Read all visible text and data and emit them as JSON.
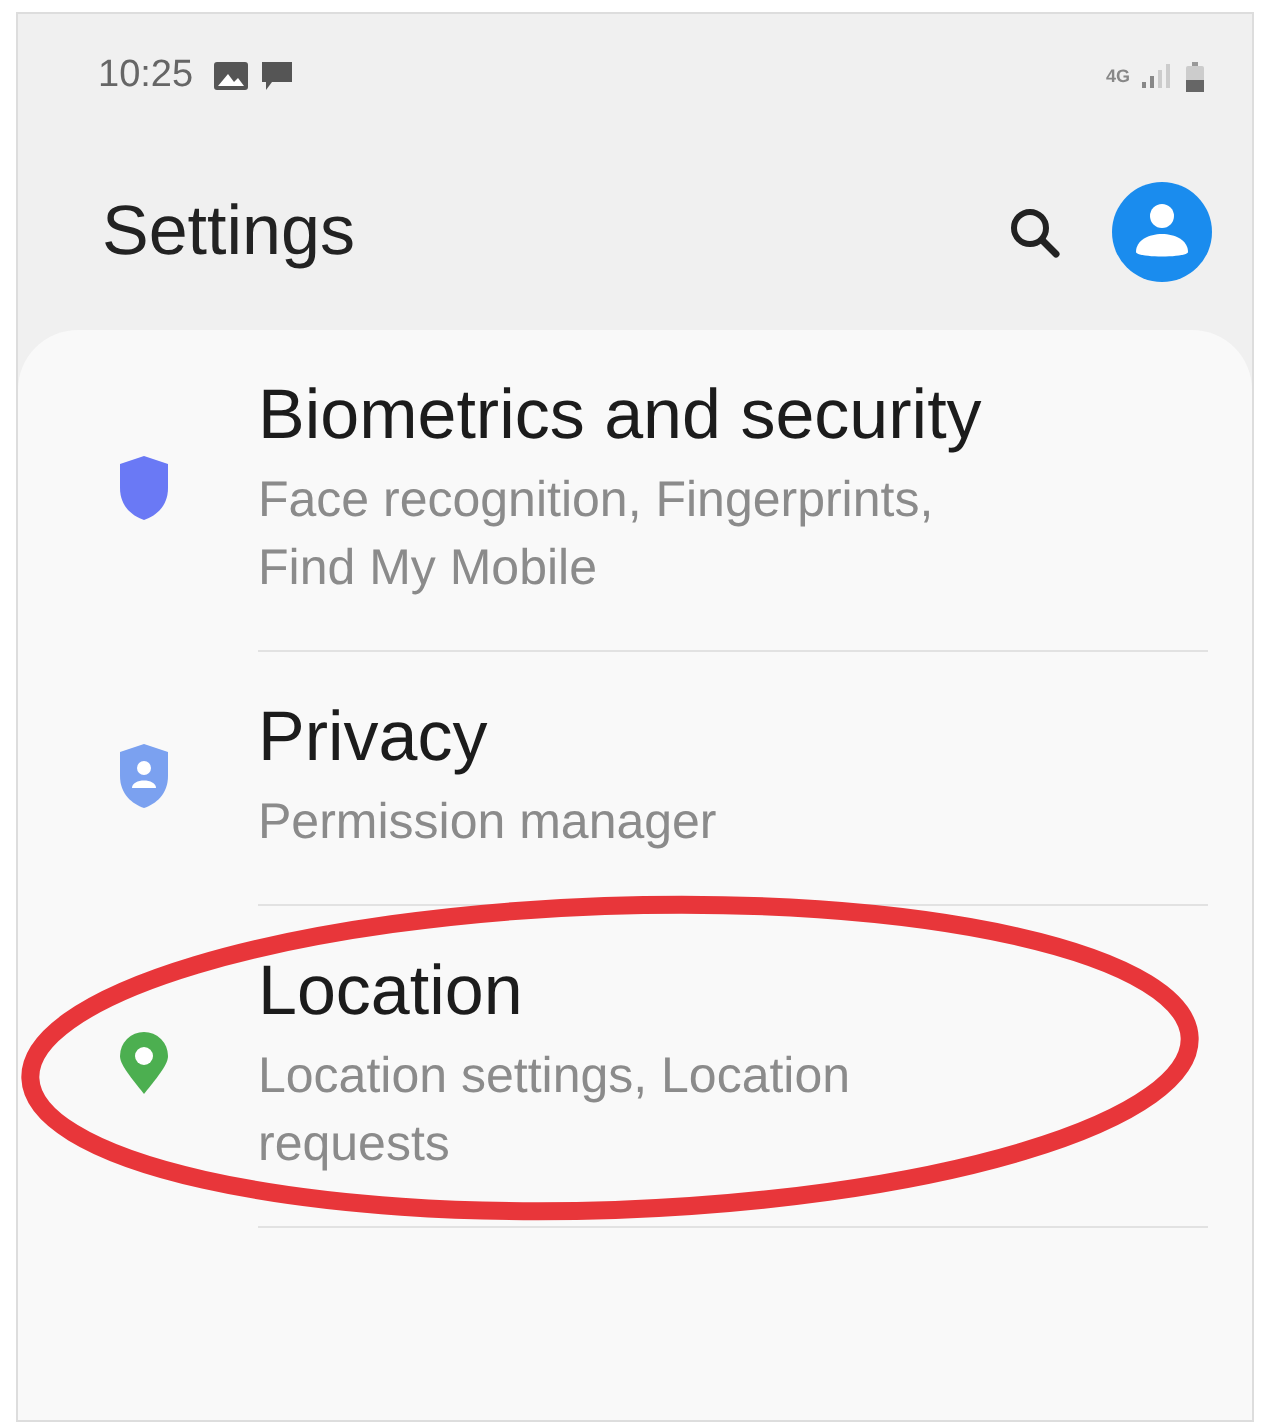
{
  "status_bar": {
    "time": "10:25",
    "network": "4G"
  },
  "header": {
    "title": "Settings"
  },
  "items": [
    {
      "kind": "shield",
      "title": "Biometrics and security",
      "subtitle": "Face recognition, Fingerprints, Find My Mobile",
      "highlighted": false
    },
    {
      "kind": "privacy",
      "title": "Privacy",
      "subtitle": "Permission manager",
      "highlighted": false
    },
    {
      "kind": "location",
      "title": "Location",
      "subtitle": "Location settings, Location requests",
      "highlighted": true
    }
  ]
}
